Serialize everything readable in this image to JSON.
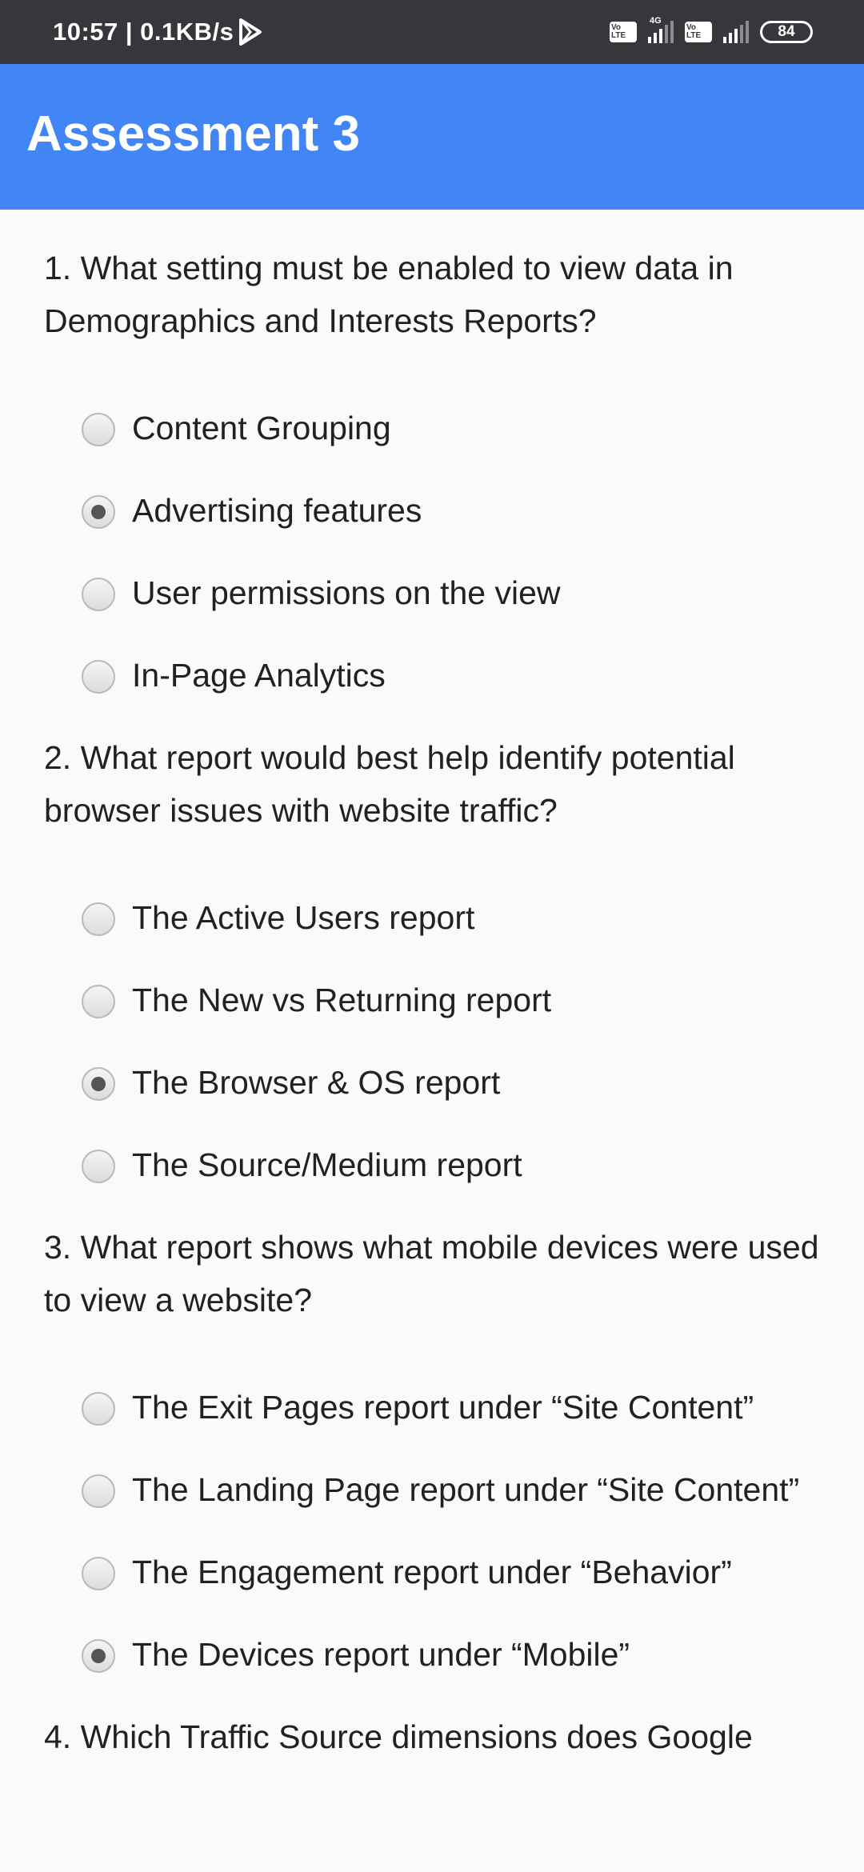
{
  "status_bar": {
    "time_speed": "10:57 | 0.1KB/s",
    "volte1": "Vo LTE",
    "network": "4G",
    "volte2": "Vo LTE",
    "battery": "84"
  },
  "app_bar": {
    "title": "Assessment 3"
  },
  "questions": [
    {
      "text": "1. What setting must be enabled to view data in Demographics and Interests Reports?",
      "options": [
        {
          "label": "Content Grouping",
          "selected": false
        },
        {
          "label": "Advertising features",
          "selected": true
        },
        {
          "label": "User permissions on the view",
          "selected": false
        },
        {
          "label": "In-Page Analytics",
          "selected": false
        }
      ]
    },
    {
      "text": "2. What report would best help identify potential browser issues with website traffic?",
      "options": [
        {
          "label": "The Active Users report",
          "selected": false
        },
        {
          "label": "The New vs Returning report",
          "selected": false
        },
        {
          "label": "The Browser & OS report",
          "selected": true
        },
        {
          "label": "The Source/Medium report",
          "selected": false
        }
      ]
    },
    {
      "text": "3. What report shows what mobile devices were used to view a website?",
      "options": [
        {
          "label": "The Exit Pages report under “Site Content”",
          "selected": false
        },
        {
          "label": "The Landing Page report under “Site Content”",
          "selected": false
        },
        {
          "label": "The Engagement report under “Behavior”",
          "selected": false
        },
        {
          "label": "The Devices report under “Mobile”",
          "selected": true
        }
      ]
    },
    {
      "text": "4. Which Traffic Source dimensions does Google",
      "options": []
    }
  ]
}
